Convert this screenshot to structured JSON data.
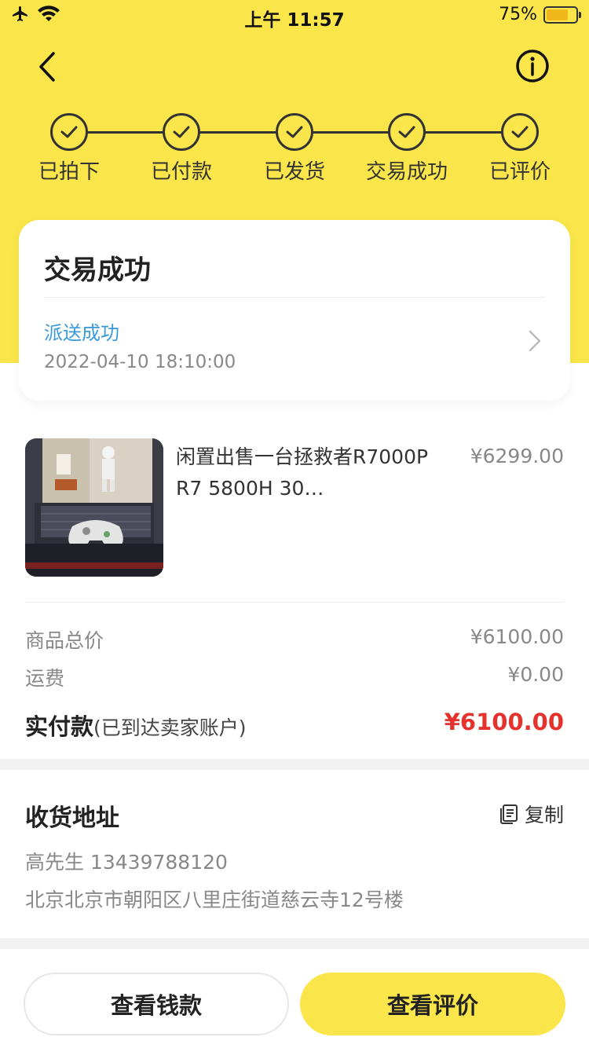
{
  "status_bar": {
    "time": "上午 11:57",
    "battery_percent": "75%",
    "battery_level": 0.75,
    "icons": [
      "airplane-icon",
      "wifi-icon",
      "battery-icon"
    ]
  },
  "nav": {
    "back_icon": "chevron-left-icon",
    "info_icon": "info-icon"
  },
  "progress": {
    "steps": [
      {
        "label": "已拍下"
      },
      {
        "label": "已付款"
      },
      {
        "label": "已发货"
      },
      {
        "label": "交易成功"
      },
      {
        "label": "已评价"
      }
    ]
  },
  "status_card": {
    "title": "交易成功",
    "delivery_status": "派送成功",
    "datetime": "2022-04-10 18:10:00"
  },
  "product": {
    "name": "闲置出售一台拯救者R7000P R7 5800H 30…",
    "price": "¥6299.00"
  },
  "summary": {
    "goods_total_label": "商品总价",
    "goods_total_value": "¥6100.00",
    "shipping_label": "运费",
    "shipping_value": "¥0.00",
    "paid_label": "实付款",
    "paid_note": "(已到达卖家账户)",
    "paid_value": "¥6100.00"
  },
  "address": {
    "title": "收货地址",
    "copy_label": "复制",
    "person": "高先生 13439788120",
    "full_address": "北京北京市朝阳区八里庄街道慈云寺12号楼"
  },
  "actions": {
    "view_payment": "查看钱款",
    "view_review": "查看评价"
  },
  "colors": {
    "brand_yellow": "#fae64a",
    "price_red": "#e5322d",
    "link_blue": "#3a9ad9"
  }
}
